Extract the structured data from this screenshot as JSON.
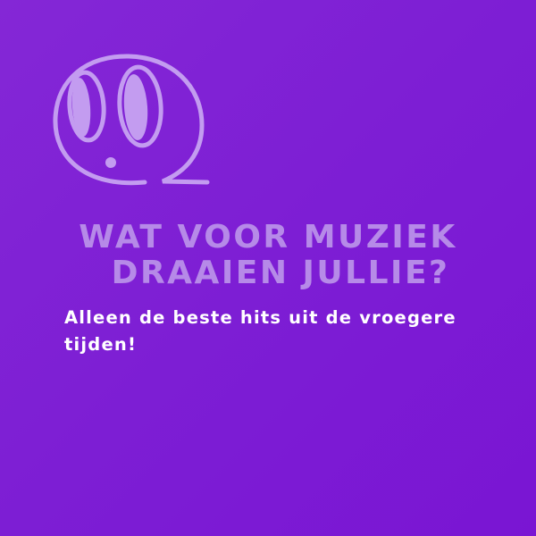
{
  "colors": {
    "background": "#7d1ed4",
    "logo": "#c39cf0",
    "heading": "#b68ae8",
    "answer": "#ffffff"
  },
  "logo": {
    "icon": "speech-bubble-face-icon"
  },
  "question": {
    "line1": "WAT VOOR MUZIEK",
    "line2": "DRAAIEN JULLIE?"
  },
  "answer": {
    "text": "Alleen de beste hits uit de vroegere tijden!"
  }
}
